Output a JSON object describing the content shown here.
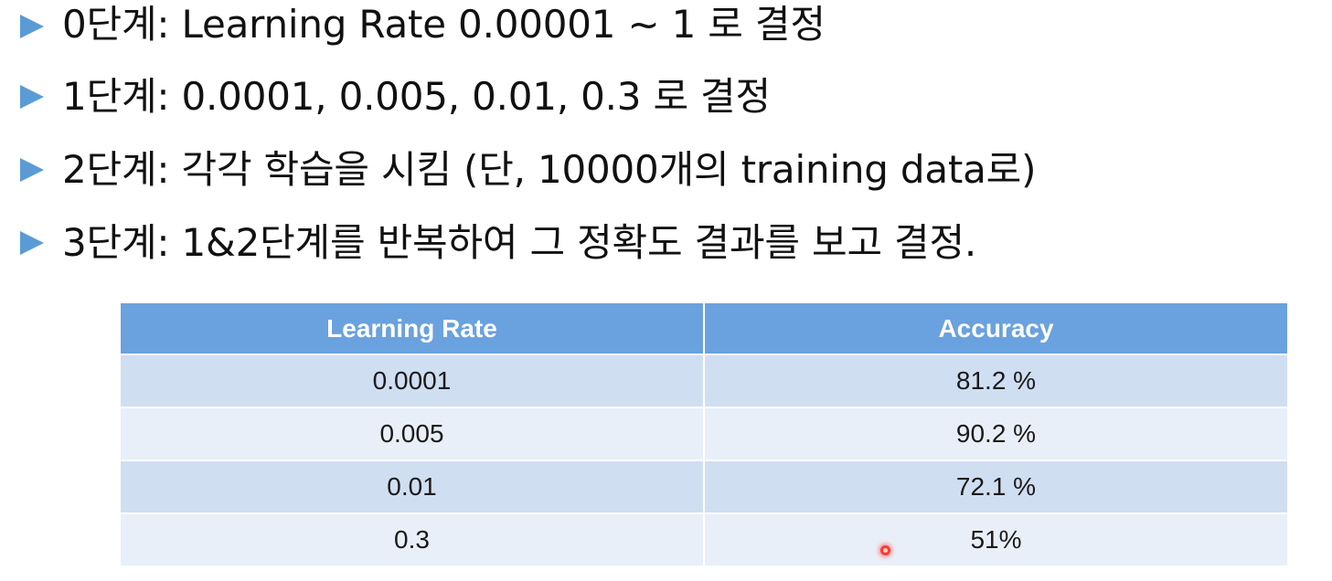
{
  "bullets": [
    "0단계: Learning Rate 0.00001 ~ 1 로 결정",
    "1단계: 0.0001, 0.005, 0.01, 0.3 로 결정",
    "2단계: 각각 학습을 시킴 (단, 10000개의 training data로)",
    "3단계: 1&2단계를 반복하여 그 정확도 결과를 보고 결정."
  ],
  "table": {
    "headers": [
      "Learning Rate",
      "Accuracy"
    ],
    "rows": [
      [
        "0.0001",
        "81.2 %"
      ],
      [
        "0.005",
        "90.2 %"
      ],
      [
        "0.01",
        "72.1 %"
      ],
      [
        "0.3",
        "51%"
      ]
    ]
  },
  "colors": {
    "bullet": "#5b9bd5",
    "header_bg": "#6aa1df",
    "row_odd": "#d0def2",
    "row_even": "#e9eff8",
    "pointer": "#ff3b30"
  }
}
